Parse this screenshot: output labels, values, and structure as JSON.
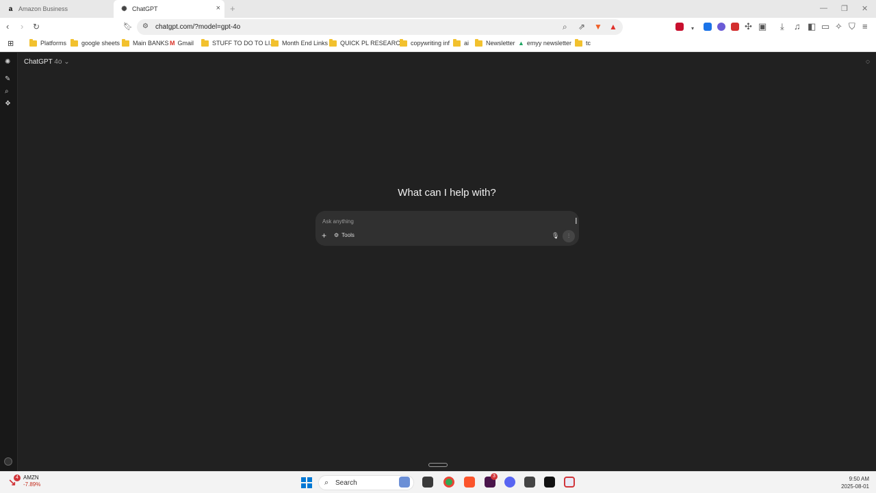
{
  "browser": {
    "tabs": [
      {
        "label": "Amazon Business",
        "favicon": "amazon-favicon",
        "active": false
      },
      {
        "label": "ChatGPT",
        "favicon": "chatgpt-favicon",
        "active": true
      }
    ],
    "close_tab_icon": "×",
    "new_tab_icon": "+",
    "url": "chatgpt.com/?model=gpt-4o",
    "window_controls": {
      "minimize": "—",
      "maximize": "❐",
      "close": "✕"
    }
  },
  "bookmarks": [
    {
      "label": "Platforms",
      "icon": "folder-icon"
    },
    {
      "label": "google sheets",
      "icon": "folder-icon"
    },
    {
      "label": "Main BANKS",
      "icon": "folder-icon"
    },
    {
      "label": "Gmail",
      "icon": "gmail-icon"
    },
    {
      "label": "STUFF TO DO TO LI...",
      "icon": "folder-icon"
    },
    {
      "label": "Month End Links",
      "icon": "folder-icon"
    },
    {
      "label": "QUICK PL RESEARC...",
      "icon": "folder-icon"
    },
    {
      "label": "copywriting inf",
      "icon": "folder-icon"
    },
    {
      "label": "ai",
      "icon": "folder-icon"
    },
    {
      "label": "Newsletter",
      "icon": "folder-icon"
    },
    {
      "label": "emyy newsletter",
      "icon": "drive-icon"
    },
    {
      "label": "tc",
      "icon": "folder-icon"
    }
  ],
  "app": {
    "model_name": "ChatGPT",
    "model_version": "4o",
    "model_chevron": "⌄",
    "heading": "What can I help with?",
    "composer": {
      "placeholder": "Ask anything",
      "plus_label": "+",
      "tools_label": "Tools"
    }
  },
  "taskbar": {
    "stock_symbol": "AMZN",
    "stock_change": "-7.89%",
    "stock_badge": "4",
    "search_label": "Search",
    "slack_badge": "3",
    "time": "9:50 AM",
    "date": "2025-08-01"
  },
  "colors": {
    "background": "#212121",
    "composer": "#303030",
    "accent_start": "#0078d4",
    "stock_down": "#c42b1c"
  }
}
